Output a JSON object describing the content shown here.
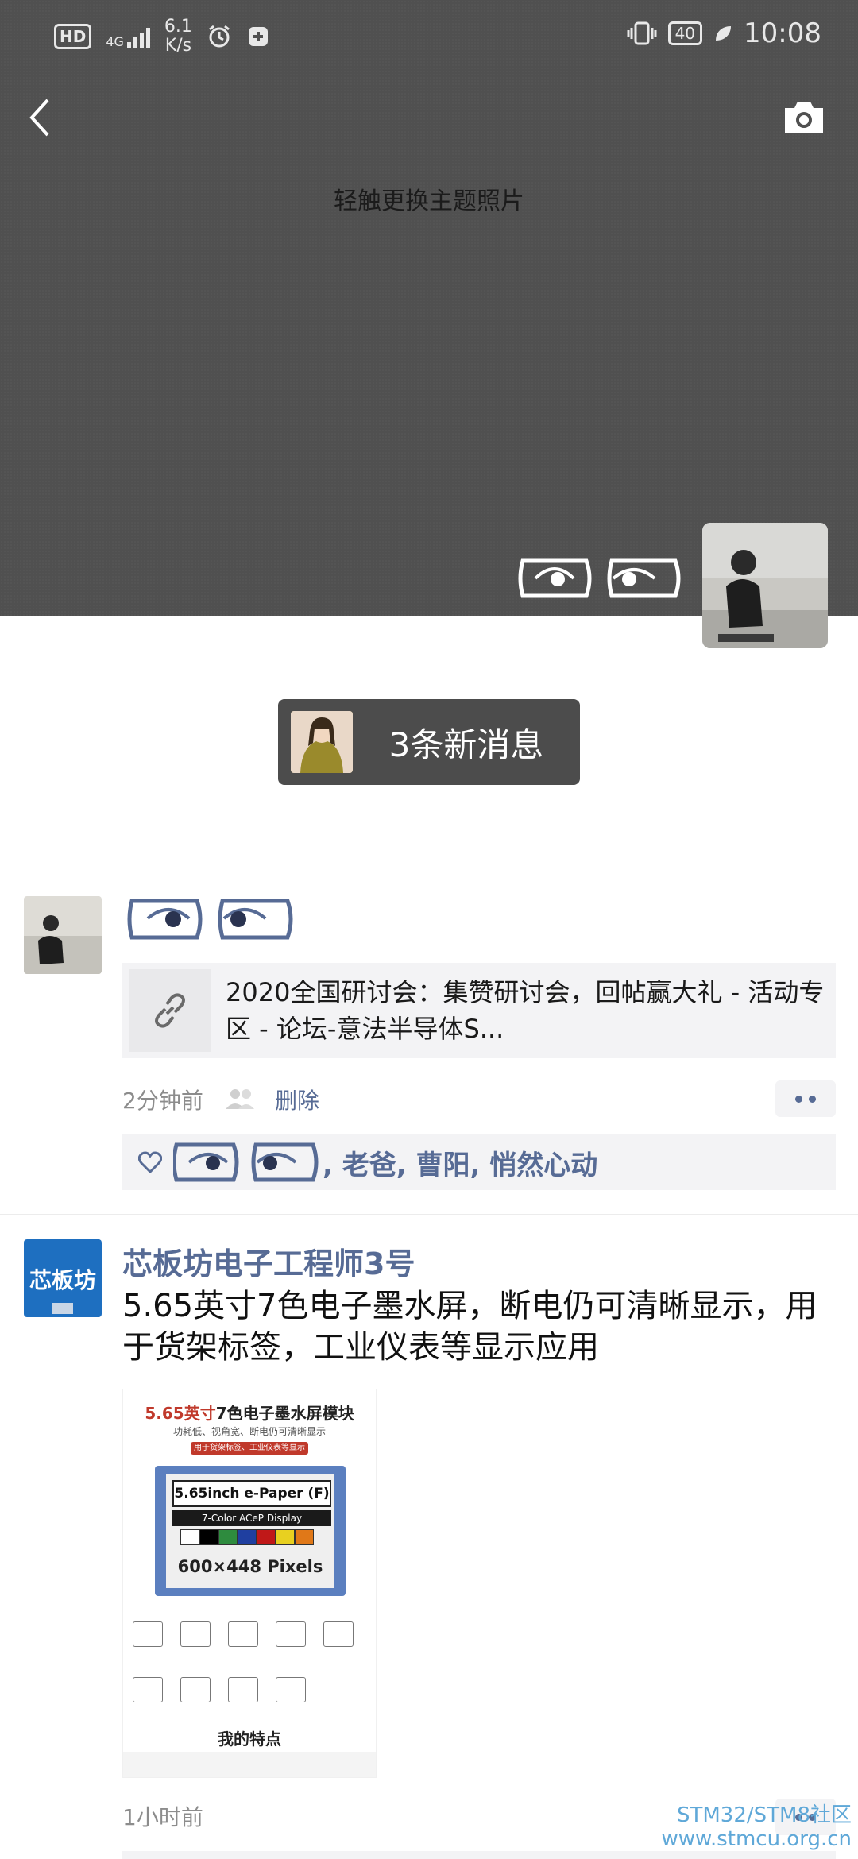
{
  "status_bar": {
    "hd": "HD",
    "network": "4G",
    "speed_value": "6.1",
    "speed_unit": "K/s",
    "battery": "40",
    "time": "10:08"
  },
  "cover": {
    "hint": "轻触更换主题照片"
  },
  "new_messages": {
    "label": "3条新消息"
  },
  "post1": {
    "link_title": "2020全国研讨会：集赞研讨会，回帖赢大礼 - 活动专区 - 论坛-意法半导体S...",
    "time": "2分钟前",
    "delete": "删除",
    "likes": [
      ", 老爸",
      ", 曹阳",
      ", 悄然心动"
    ]
  },
  "post2": {
    "avatar_text": "芯板坊",
    "author": "芯板坊电子工程师3号",
    "text": "5.65英寸7色电子墨水屏，断电仍可清晰显示，用于货架标签，工业仪表等显示应用",
    "image": {
      "title_red": "5.65英寸",
      "title_dark": "7色电子墨水屏模块",
      "subtitle": "功耗低、视角宽、断电仍可清晰显示",
      "tag": "用于货架标签、工业仪表等显示",
      "screen_line1": "5.65inch e-Paper (F)",
      "screen_line2": "7-Color ACeP Display",
      "screen_line3": "600×448 Pixels",
      "features": "我的特点",
      "colors": [
        "#ffffff",
        "#000000",
        "#2e8b3e",
        "#1f3fa0",
        "#c01818",
        "#e8d020",
        "#e07818"
      ]
    },
    "time": "1小时前"
  },
  "watermark": {
    "line1": "STM32/STM8社区",
    "line2": "www.stmcu.org.cn"
  }
}
